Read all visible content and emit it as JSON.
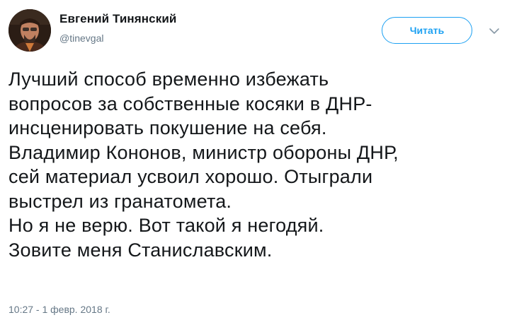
{
  "author": {
    "name": "Евгений Тинянский",
    "handle": "@tinevgal"
  },
  "actions": {
    "follow_label": "Читать",
    "more_icon": "chevron-down-icon"
  },
  "tweet": {
    "lines": [
      "Лучший способ временно избежать",
      "вопросов за собственные косяки в ДНР-",
      "инсценировать покушение на себя.",
      "Владимир Кононов, министр обороны ДНР,",
      "сей материал усвоил хорошо. Отыграли",
      "выстрел из гранатомета.",
      "Но я не верю. Вот такой я негодяй.",
      "Зовите меня Станиславским."
    ],
    "timestamp": "10:27 - 1 февр. 2018 г."
  },
  "colors": {
    "accent": "#1da1f2",
    "text": "#14171a",
    "secondary": "#657786"
  }
}
